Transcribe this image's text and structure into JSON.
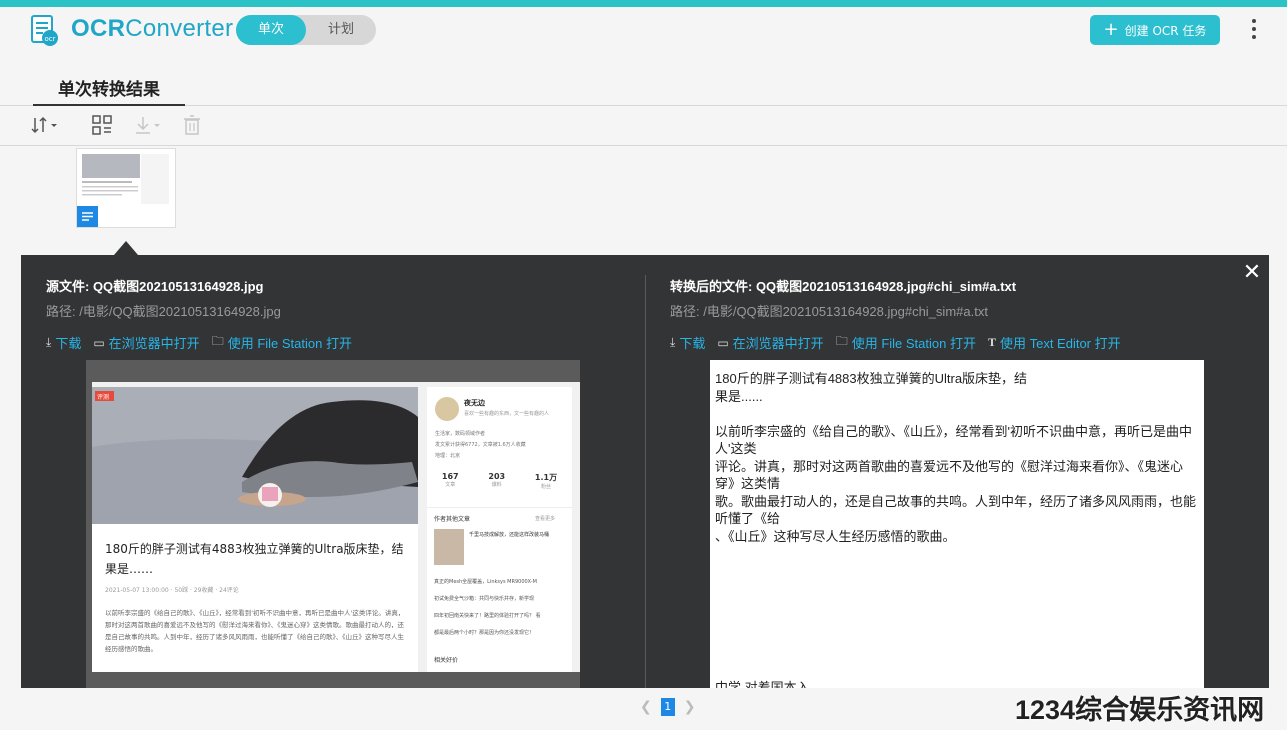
{
  "app": {
    "name_bold": "OCR",
    "name_rest": "Converter",
    "modes": {
      "active": "单次",
      "inactive": "计划"
    },
    "create_label": "创建 OCR 任务",
    "accent_color": "#2bbfd0",
    "link_color": "#27b6e8"
  },
  "tab": {
    "label": "单次转换结果"
  },
  "toolbar": {
    "icons": [
      "sort-icon",
      "grid-icon",
      "download-icon",
      "trash-icon"
    ]
  },
  "source": {
    "title": "源文件: QQ截图20210513164928.jpg",
    "path": "路径: /电影/QQ截图20210513164928.jpg",
    "actions": [
      "下载",
      "在浏览器中打开",
      "使用 File Station 打开"
    ]
  },
  "converted": {
    "title": "转换后的文件: QQ截图20210513164928.jpg#chi_sim#a.txt",
    "path": "路径: /电影/QQ截图20210513164928.jpg#chi_sim#a.txt",
    "actions": [
      "下载",
      "在浏览器中打开",
      "使用 File Station 打开",
      "使用 Text Editor 打开"
    ],
    "text_lines": [
      "180斤的胖子测试有4883枚独立弹簧的Ultra版床垫，结",
      "果是......",
      "",
      "以前听李宗盛的《给自己的歌》、《山丘》，经常看到'初听不识曲中意，再听已是曲中人'这类",
      "评论。讲真，那时对这两首歌曲的喜爱远不及他写的《慰洋过海来看你》、《鬼迷心穿》这类情",
      "歌。歌曲最打动人的，还是自己故事的共鸣。人到中年，经历了诸多风风雨雨，也能听懂了《给",
      "、《山丘》这种写尽人生经历感悟的歌曲。"
    ],
    "tail_line": "中学 对着国本入"
  },
  "preview": {
    "tag": "评测",
    "article_title": "180斤的胖子测试有4883枚独立弹簧的Ultra版床垫，结果是……",
    "meta": "2021-05-07 13:00:00 · 50踩 · 29收藏 · 24评论",
    "body": "以前听李宗盛的《给自己的歌》、《山丘》，经常看到'初听不识曲中意，再听已是曲中人'这类评论。讲真，那时对这两首歌曲的喜爱远不及他写的《慰洋过海来看你》、《鬼迷心穿》这类情歌。歌曲最打动人的，还是自己故事的共鸣。人到中年，经历了诸多风风雨雨，也能听懂了《给自己的歌》、《山丘》这种写尽人生经历感悟的歌曲。",
    "author_name": "夜无边",
    "author_bio": "喜欢一些有趣的东西，文一些有趣的人",
    "author_items": [
      "生活家，数码领域作者",
      "发文累计获得6772，文章被1.6万人收藏",
      "地理：北京"
    ],
    "stats": [
      {
        "value": "167",
        "label": "文章"
      },
      {
        "value": "203",
        "label": "爆料"
      },
      {
        "value": "1.1万",
        "label": "粉丝"
      }
    ],
    "other_heading": "作者其他文章",
    "other_more": "查看更多",
    "other_title": "千里马技成解放，还能这样改装马桶",
    "other_lines": [
      "真正的Mesh全屋覆盖，Linksys MR9000X-M",
      "初试免费全气沙箱：共同与快乐并存，新学现",
      "四年初回南关快来了！路里的体验打开了吗？ 看",
      "都是最后两个小时？那是因为你还没发现它！"
    ],
    "related": "相关好价"
  },
  "pager": {
    "current": "1"
  },
  "watermark": "1234综合娱乐资讯网"
}
